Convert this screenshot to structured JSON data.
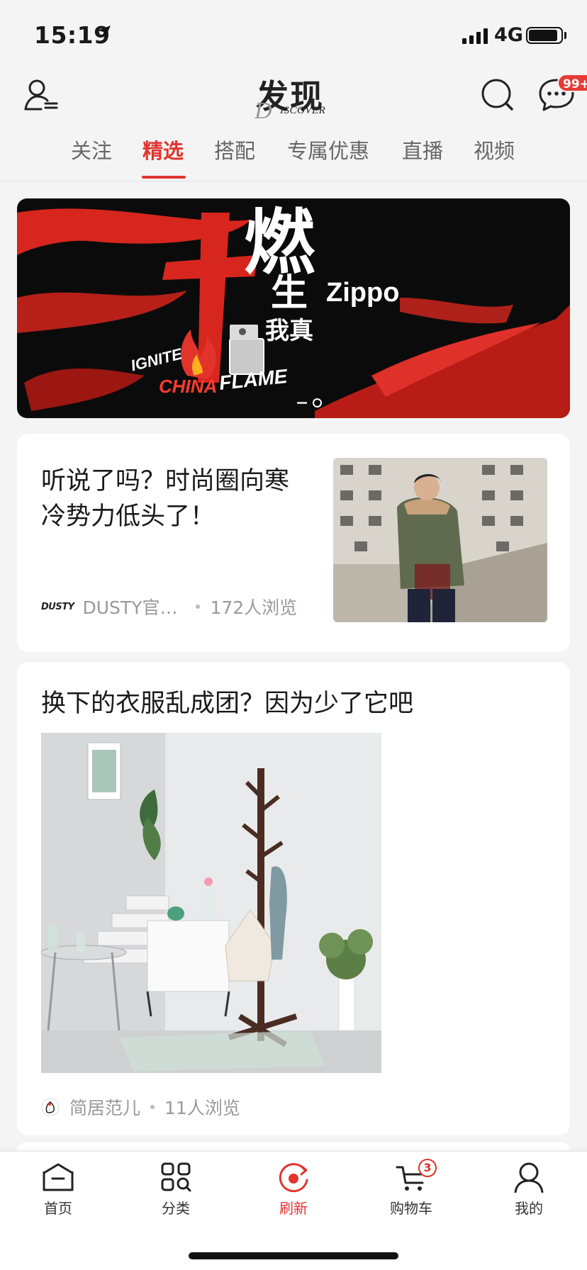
{
  "status_bar": {
    "time": "15:19",
    "network": "4G",
    "battery_percent": 90
  },
  "header": {
    "title_main": "发现",
    "title_sub": "ISCOVER",
    "title_sub_initial": "D",
    "message_badge": "99+"
  },
  "tabs": [
    {
      "label": "关注",
      "active": false
    },
    {
      "label": "精选",
      "active": true
    },
    {
      "label": "搭配",
      "active": false
    },
    {
      "label": "专属优惠",
      "active": false
    },
    {
      "label": "直播",
      "active": false
    },
    {
      "label": "视频",
      "active": false
    }
  ],
  "banner": {
    "slide_count": 2,
    "current_slide": 2,
    "text": {
      "calligraphy": "燃",
      "line2": "生",
      "line3": "我真",
      "brand": "Zippo",
      "slogan1": "IGNITE",
      "slogan2": "CHINA",
      "slogan3": "FLAME"
    }
  },
  "feed": [
    {
      "title": "听说了吗？时尚圈向寒冷势力低头了！",
      "source_logo": "DUSTY",
      "source": "DUSTY官…",
      "views": "172人浏览"
    },
    {
      "title": "换下的衣服乱成团？因为少了它吧",
      "source": "简居范儿",
      "views": "11人浏览"
    }
  ],
  "bottom_nav": [
    {
      "label": "首页",
      "icon": "home-icon",
      "active": false
    },
    {
      "label": "分类",
      "icon": "category-icon",
      "active": false
    },
    {
      "label": "刷新",
      "icon": "refresh-icon",
      "active": true
    },
    {
      "label": "购物车",
      "icon": "cart-icon",
      "active": false,
      "badge": "3"
    },
    {
      "label": "我的",
      "icon": "profile-icon",
      "active": false
    }
  ],
  "colors": {
    "accent": "#e2342f",
    "background": "#f4f4f4",
    "card": "#ffffff"
  }
}
